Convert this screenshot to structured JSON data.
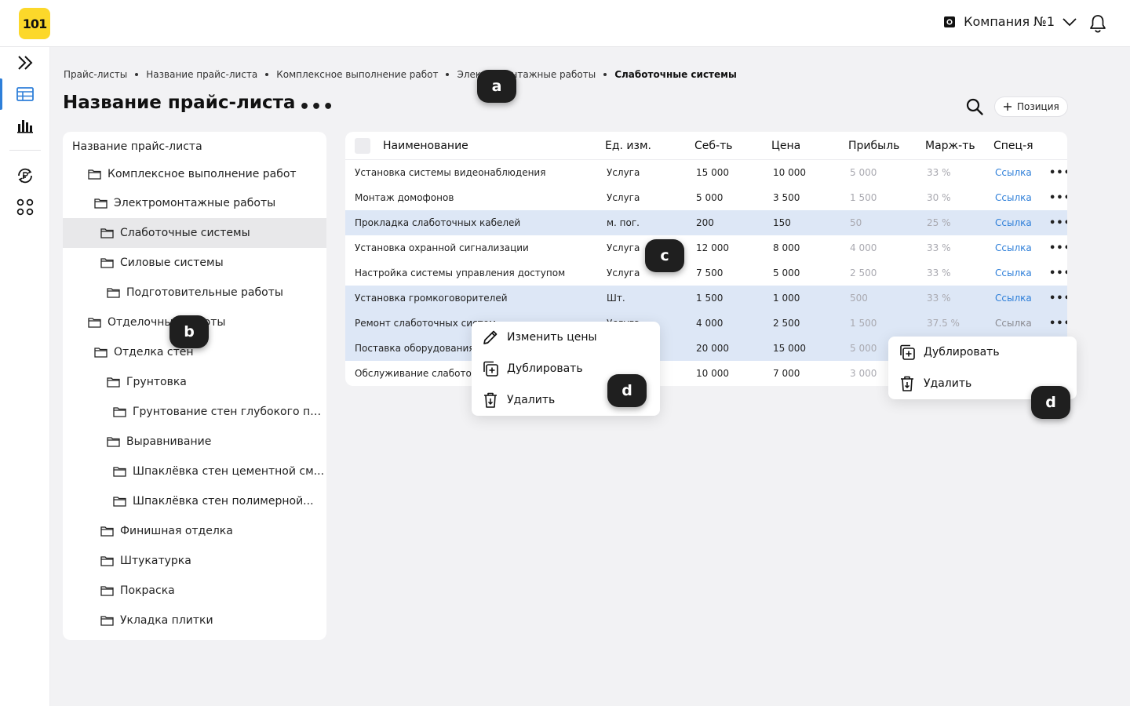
{
  "header": {
    "logo_text": "101",
    "company_name": "Компания №1"
  },
  "breadcrumb": [
    "Прайс-листы",
    "Название прайс-листа",
    "Комплексное выполнение работ",
    "Электромонтажные работы",
    "Слаботочные системы"
  ],
  "page": {
    "title": "Название прайс-листа",
    "title_menu": "•••",
    "add_position_label": "Позиция"
  },
  "tree": {
    "items": [
      {
        "label": "Название прайс-листа"
      },
      {
        "label": "Комплексное выполнение работ"
      },
      {
        "label": "Электромонтажные работы"
      },
      {
        "label": "Слаботочные системы"
      },
      {
        "label": "Силовые системы"
      },
      {
        "label": "Подготовительные работы"
      },
      {
        "label": "Отделочные работы"
      },
      {
        "label": "Отделка стен"
      },
      {
        "label": "Грунтовка"
      },
      {
        "label": "Грунтование стен глубокого пр..."
      },
      {
        "label": "Выравнивание"
      },
      {
        "label": "Шпаклёвка стен цементной см..."
      },
      {
        "label": "Шпаклёвка стен полимерной..."
      },
      {
        "label": "Финишная отделка"
      },
      {
        "label": "Штукатурка"
      },
      {
        "label": "Покраска"
      },
      {
        "label": "Укладка плитки"
      }
    ]
  },
  "table": {
    "columns": [
      "Наименование",
      "Ед. изм.",
      "Себ-ть",
      "Цена",
      "Прибыль",
      "Марж-ть",
      "Спец-я"
    ],
    "row_menu": "•••",
    "rows": [
      {
        "name": "Установка системы видеонаблюдения",
        "unit": "Услуга",
        "cost": "15 000",
        "price": "10 000",
        "profit": "5 000",
        "margin": "33 %",
        "spec": "Ссылка"
      },
      {
        "name": "Монтаж домофонов",
        "unit": "Услуга",
        "cost": "5 000",
        "price": "3 500",
        "profit": "1 500",
        "margin": "30 %",
        "spec": "Ссылка"
      },
      {
        "name": "Прокладка слаботочных кабелей",
        "unit": "м. пог.",
        "cost": "200",
        "price": "150",
        "profit": "50",
        "margin": "25 %",
        "spec": "Ссылка"
      },
      {
        "name": "Установка охранной сигнализации",
        "unit": "Услуга",
        "cost": "12 000",
        "price": "8 000",
        "profit": "4 000",
        "margin": "33 %",
        "spec": "Ссылка"
      },
      {
        "name": "Настройка системы управления доступом",
        "unit": "Услуга",
        "cost": "7 500",
        "price": "5 000",
        "profit": "2 500",
        "margin": "33 %",
        "spec": "Ссылка"
      },
      {
        "name": "Установка громкоговорителей",
        "unit": "Шт.",
        "cost": "1 500",
        "price": "1 000",
        "profit": "500",
        "margin": "33 %",
        "spec": "Ссылка"
      },
      {
        "name": "Ремонт слаботочных систем",
        "unit": "Услуга",
        "cost": "4 000",
        "price": "2 500",
        "profit": "1 500",
        "margin": "37.5 %",
        "spec": "Ссылка"
      },
      {
        "name": "Поставка оборудования",
        "unit": "",
        "cost": "20 000",
        "price": "15 000",
        "profit": "5 000",
        "margin": "",
        "spec": ""
      },
      {
        "name": "Обслуживание слаботочных систем",
        "unit": "",
        "cost": "10 000",
        "price": "7 000",
        "profit": "3 000",
        "margin": "",
        "spec": ""
      }
    ]
  },
  "context_menu_group": {
    "items": [
      "Изменить цены",
      "Дублировать",
      "Удалить"
    ]
  },
  "context_menu_row": {
    "items": [
      "Дублировать",
      "Удалить"
    ]
  },
  "markers": [
    "a",
    "b",
    "c",
    "d",
    "d"
  ],
  "colors": {
    "brand_yellow": "#fcd82a",
    "accent_blue": "#2e7fd9",
    "row_highlight": "#dde7f6"
  }
}
